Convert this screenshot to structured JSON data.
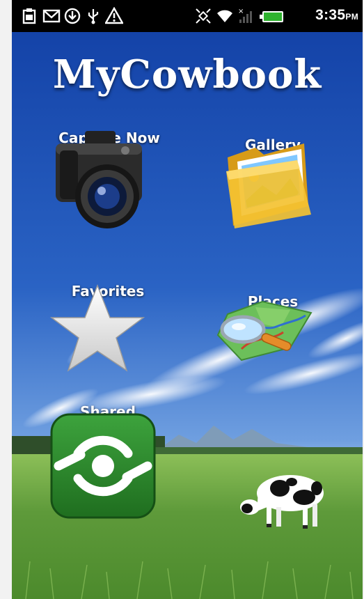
{
  "status_bar": {
    "time": "3:35",
    "ampm": "PM",
    "icons": [
      "clipboard-icon",
      "gmail-icon",
      "download-icon",
      "usb-icon",
      "warning-icon",
      "gps-icon",
      "wifi-icon",
      "signal-icon",
      "battery-icon"
    ]
  },
  "app": {
    "title": "MyCowbook"
  },
  "menu": {
    "capture": "Capture Now",
    "gallery": "Gallery",
    "favorites": "Favorites",
    "places": "Places",
    "shared": "Shared"
  },
  "colors": {
    "sky_top": "#1443a8",
    "sky_bottom": "#8fb6e6",
    "grass": "#5e9a3a",
    "shared_green": "#2e8b2e"
  }
}
